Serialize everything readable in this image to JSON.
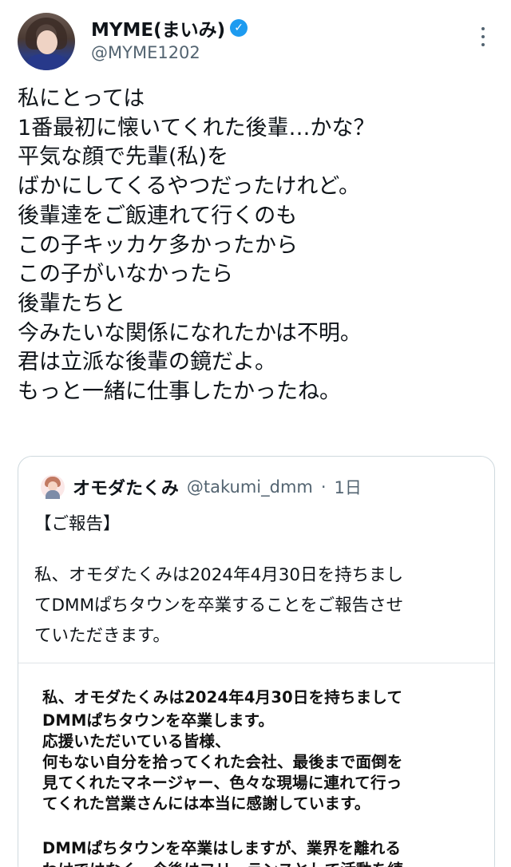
{
  "author": {
    "display_name": "MYME(まいみ)",
    "handle": "@MYME1202",
    "avatar_icon": "profile-photo",
    "verified_icon": "verified-badge-icon",
    "verified_color": "#1d9bf0"
  },
  "tweet_lines": [
    "私にとっては",
    "1番最初に懐いてくれた後輩…かな？",
    "平気な顔で先輩(私)を",
    "ばかにしてくるやつだったけれど。",
    "後輩達をご飯連れて行くのも",
    "この子キッカケ多かったから",
    "この子がいなかったら",
    "後輩たちと",
    "今みたいな関係になれたかは不明。",
    "君は立派な後輩の鏡だよ。",
    "もっと一緒に仕事したかったね。"
  ],
  "quoted": {
    "display_name": "オモダたくみ",
    "handle": "@takumi_dmm",
    "dot": "·",
    "time": "1日",
    "text_lines": [
      "【ご報告】",
      "",
      "私、オモダたくみは2024年4月30日を持ちまし",
      "てDMMぱちタウンを卒業することをご報告させ",
      "ていただきます。"
    ],
    "image_lines": [
      "私、オモダたくみは2024年4月30日を持ちまして",
      "DMMぱちタウンを卒業します。",
      "応援いただいている皆様、",
      "何もない自分を拾ってくれた会社、最後まで面倒を",
      "見てくれたマネージャー、色々な現場に連れて行っ",
      "てくれた営業さんには本当に感謝しています。",
      "",
      "DMMぱちタウンを卒業はしますが、業界を離れる",
      "わけではなく、今後はフリーランスとして活動を続"
    ]
  },
  "colors": {
    "text": "#0f1419",
    "secondary": "#536471",
    "border": "#cfd9de",
    "accent": "#1d9bf0"
  }
}
